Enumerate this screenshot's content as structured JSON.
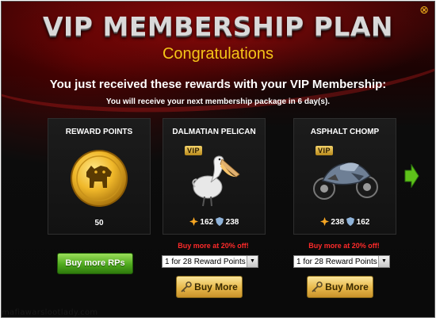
{
  "dialog": {
    "title": "VIP MEMBERSHIP PLAN",
    "subtitle": "Congratulations",
    "message": "You just received these rewards with your VIP Membership:",
    "next_package": "You will receive your next membership package in 6 day(s).",
    "close_icon": "close-icon"
  },
  "rewards": [
    {
      "title": "REWARD POINTS",
      "count": "50",
      "icon": "zynga-coin-icon",
      "button_label": "Buy more RPs"
    },
    {
      "title": "DALMATIAN PELICAN",
      "badge": "VIP",
      "attack": "162",
      "defense": "238",
      "icon": "pelican-icon",
      "promo": "Buy more at 20% off!",
      "select_value": "1 for 28 Reward Points",
      "button_label": "Buy More"
    },
    {
      "title": "ASPHALT CHOMP",
      "badge": "VIP",
      "attack": "238",
      "defense": "162",
      "icon": "motorcycle-icon",
      "promo": "Buy more at 20% off!",
      "select_value": "1 for 28 Reward Points",
      "button_label": "Buy More"
    }
  ],
  "navigation": {
    "next_icon": "next-arrow-icon"
  },
  "watermark": "mafiawarslootlady.com",
  "colors": {
    "title_gold": "#f5c518",
    "promo_red": "#ff2a2a",
    "buy_button_gold": "#e7b84a",
    "rp_button_green": "#4faa1e",
    "arrow_green": "#5ec21a"
  }
}
